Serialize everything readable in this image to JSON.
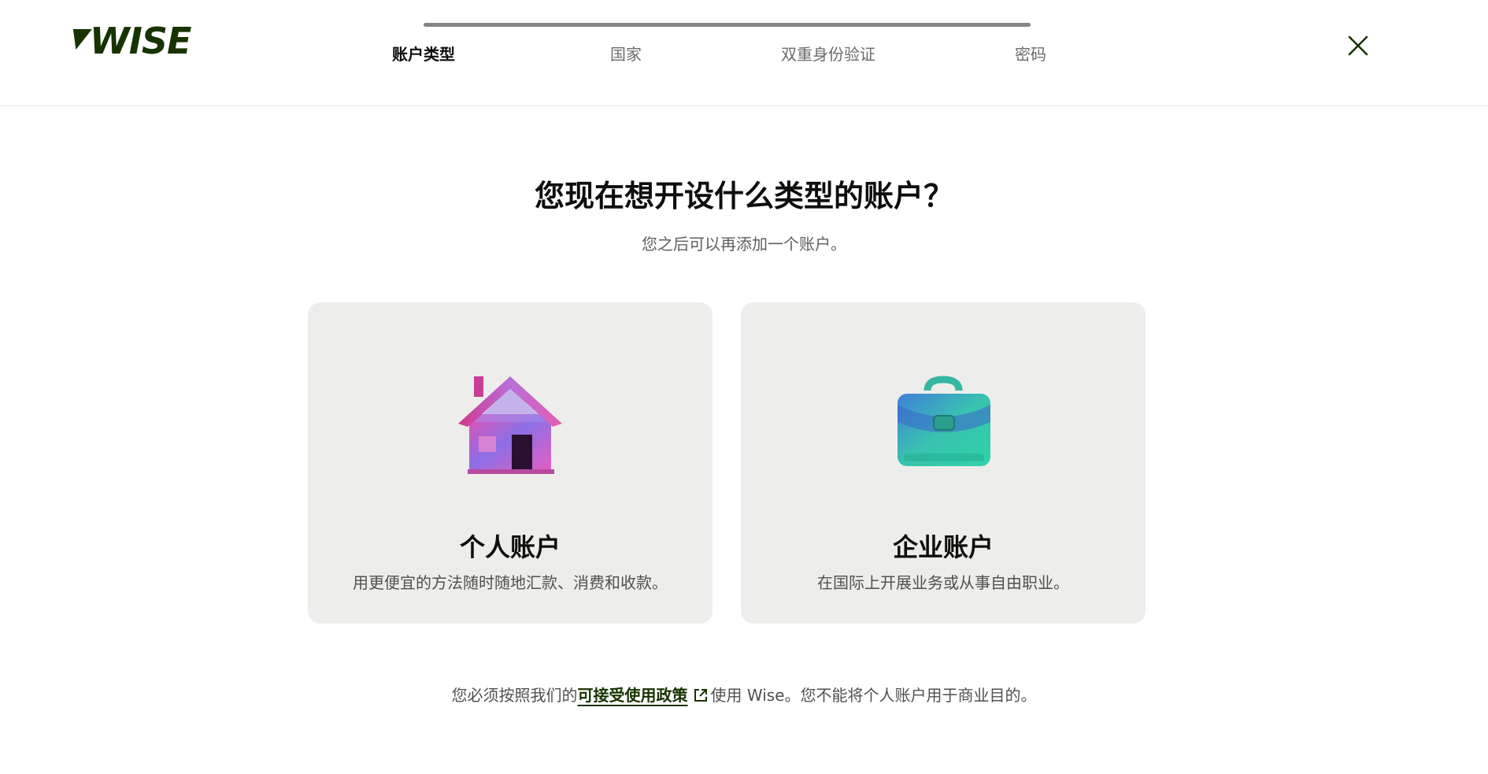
{
  "brand": {
    "name": "WISE",
    "color": "#163300"
  },
  "stepper": {
    "progress": 1.0,
    "steps": [
      {
        "label": "账户类型",
        "active": true
      },
      {
        "label": "国家",
        "active": false
      },
      {
        "label": "双重身份验证",
        "active": false
      },
      {
        "label": "密码",
        "active": false
      }
    ]
  },
  "close_icon": "close-icon",
  "main": {
    "title": "您现在想开设什么类型的账户？",
    "subtitle": "您之后可以再添加一个账户。"
  },
  "cards": [
    {
      "icon": "house-icon",
      "title": "个人账户",
      "description": "用更便宜的方法随时随地汇款、消费和收款。"
    },
    {
      "icon": "briefcase-icon",
      "title": "企业账户",
      "description": "在国际上开展业务或从事自由职业。"
    }
  ],
  "footer": {
    "prefix": "您必须按照我们的",
    "link_label": "可接受使用政策",
    "link_icon": "external-link-icon",
    "suffix": "使用 Wise。您不能将个人账户用于商业目的。"
  },
  "colors": {
    "card_background": "#edeeeb",
    "link": "#163300",
    "stepper_fill": "#868685"
  }
}
